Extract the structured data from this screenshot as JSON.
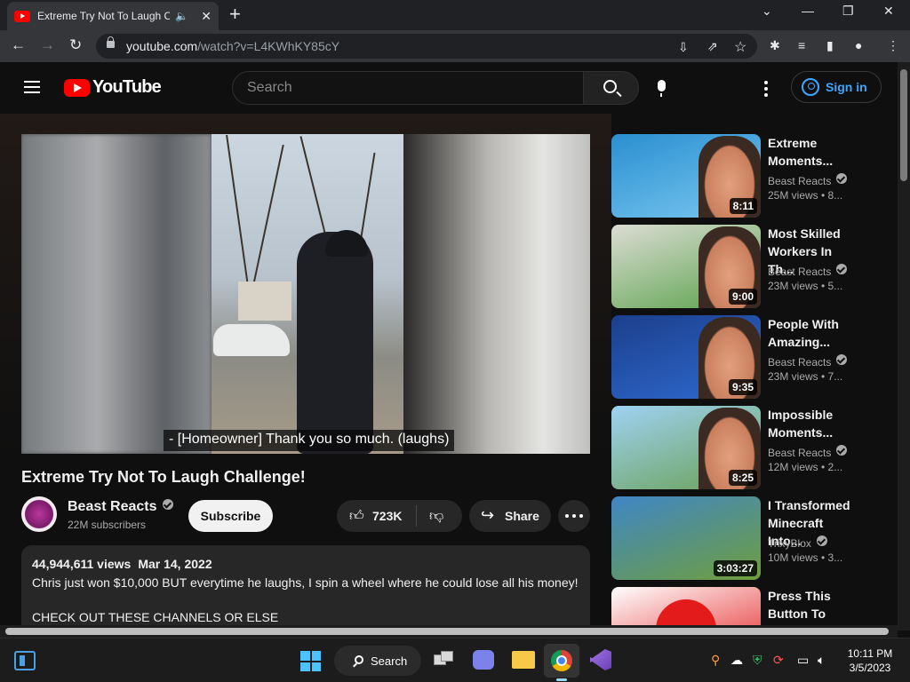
{
  "browser": {
    "tab_title": "Extreme Try Not To Laugh Challenge!",
    "speaker_glyph": "🔈",
    "close_glyph": "✕",
    "new_tab_glyph": "+",
    "url_host": "youtube.com",
    "url_path": "/watch?v=L4KWhKY85cY",
    "window_controls": [
      "⌄",
      "—",
      "❐",
      "✕"
    ]
  },
  "youtube": {
    "logo_text": "YouTube",
    "search_placeholder": "Search",
    "sign_in": "Sign in"
  },
  "video": {
    "caption": "- [Homeowner] Thank you so much. (laughs)",
    "title": "Extreme Try Not To Laugh Challenge!",
    "channel": "Beast Reacts",
    "subscribers": "22M subscribers",
    "subscribe_label": "Subscribe",
    "likes": "723K",
    "share_label": "Share",
    "views": "44,944,611 views",
    "date": "Mar 14, 2022",
    "description_line1": "Chris just won $10,000 BUT everytime he laughs, I spin a wheel where he could lose all his money!",
    "description_line2": "CHECK OUT THESE CHANNELS OR ELSE"
  },
  "recommendations": [
    {
      "title": "Extreme Moments...",
      "channel": "Beast Reacts",
      "verified": true,
      "views": "25M views • 8...",
      "duration": "8:11",
      "colors": [
        "#2a8fd0",
        "#79c7f0"
      ]
    },
    {
      "title": "Most Skilled Workers In Th...",
      "channel": "Beast Reacts",
      "verified": true,
      "views": "23M views • 5...",
      "duration": "9:00",
      "colors": [
        "#dcdcd4",
        "#59a24a"
      ]
    },
    {
      "title": "People With Amazing...",
      "channel": "Beast Reacts",
      "verified": true,
      "views": "23M views • 7...",
      "duration": "9:35",
      "colors": [
        "#1c3f8c",
        "#2e6ad0"
      ]
    },
    {
      "title": "Impossible Moments...",
      "channel": "Beast Reacts",
      "verified": true,
      "views": "12M views • 2...",
      "duration": "8:25",
      "colors": [
        "#9fd2f3",
        "#6aa055"
      ]
    },
    {
      "title": "I Transformed Minecraft Into...",
      "channel": "TrixyBlox",
      "verified": true,
      "views": "10M views • 3...",
      "duration": "3:03:27",
      "colors": [
        "#3f86c6",
        "#6f9e3e"
      ]
    },
    {
      "title": "Press This Button To Win...",
      "channel": "",
      "verified": false,
      "views": "",
      "duration": "",
      "colors": [
        "#ffffff",
        "#e31b1b"
      ]
    }
  ],
  "taskbar": {
    "search_label": "Search",
    "time": "10:11 PM",
    "date": "3/5/2023"
  }
}
